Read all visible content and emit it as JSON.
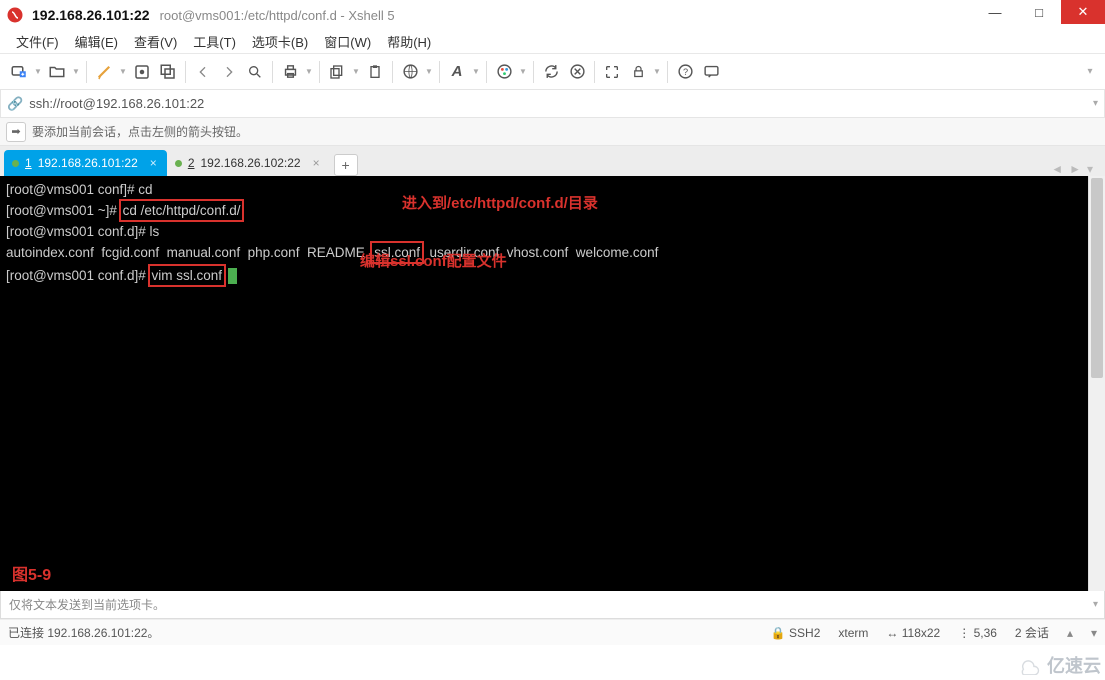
{
  "title": {
    "address": "192.168.26.101:22",
    "path": "root@vms001:/etc/httpd/conf.d - Xshell 5"
  },
  "menu": {
    "file": "文件(F)",
    "edit": "编辑(E)",
    "view": "查看(V)",
    "tools": "工具(T)",
    "tab": "选项卡(B)",
    "window": "窗口(W)",
    "help": "帮助(H)"
  },
  "address_bar": {
    "icon_label": "link-icon",
    "url": "ssh://root@192.168.26.101:22"
  },
  "info_bar": {
    "text": "要添加当前会话，点击左侧的箭头按钮。"
  },
  "tabs": [
    {
      "index": "1",
      "label": "192.168.26.101:22",
      "active": true
    },
    {
      "index": "2",
      "label": "192.168.26.102:22",
      "active": false
    }
  ],
  "terminal": {
    "lines": [
      {
        "prompt": "[root@vms001 conf]# ",
        "cmd": "cd",
        "box_cmd": false
      },
      {
        "prompt": "[root@vms001 ~]# ",
        "cmd": "cd /etc/httpd/conf.d/",
        "box_cmd": true
      },
      {
        "prompt": "[root@vms001 conf.d]# ",
        "cmd": "ls"
      },
      {
        "raw": "autoindex.conf  fcgid.conf  manual.conf  php.conf  README  ssl.conf  userdir.conf  vhost.conf  welcome.conf",
        "highlight": "ssl.conf"
      },
      {
        "prompt": "[root@vms001 conf.d]# ",
        "cmd": "vim ssl.conf",
        "box_cmd": true,
        "cursor": true
      }
    ],
    "annotations": {
      "a1": "进入到/etc/httpd/conf.d/目录",
      "a2": "编辑ssl.conf配置文件"
    },
    "figure_label": "图5-9"
  },
  "hint_bar": {
    "text": "仅将文本发送到当前选项卡。"
  },
  "status": {
    "connected": "已连接 192.168.26.101:22。",
    "proto": "SSH2",
    "term": "xterm",
    "size": "118x22",
    "pos": "5,36",
    "sessions": "2 会话"
  },
  "watermark": "亿速云",
  "toolbar_icons": [
    "new-session",
    "open",
    "sep",
    "script",
    "settings",
    "copy-session",
    "sep",
    "back",
    "forward",
    "search",
    "sep",
    "print",
    "sep",
    "copy",
    "paste",
    "sep",
    "globe",
    "sep",
    "font",
    "sep",
    "color",
    "sep",
    "reconnect",
    "disconnect",
    "sep",
    "fullscreen",
    "lock",
    "sep",
    "help",
    "feedback"
  ]
}
